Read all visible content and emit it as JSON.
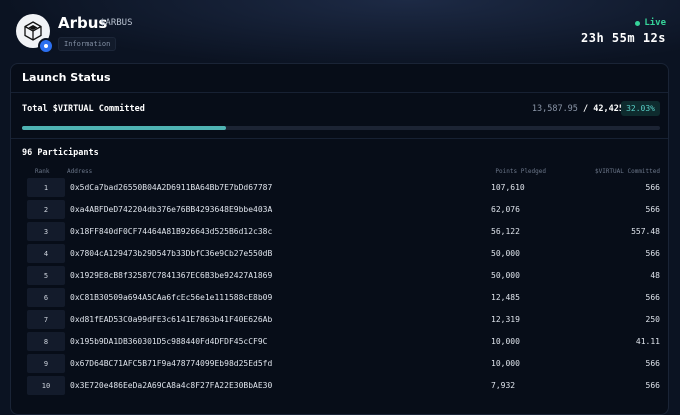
{
  "header": {
    "name": "Arbus",
    "ticker": "$ARBUS",
    "info_badge": "Information",
    "live_label": "Live",
    "countdown": "23h 55m 12s",
    "logo_icon": "cube-logo-icon",
    "verified_icon": "verified-badge-icon"
  },
  "launch": {
    "title": "Launch Status",
    "committed_label": "Total $VIRTUAL Committed",
    "committed_value": "13,587.95",
    "committed_sep": " / ",
    "committed_target": "42,425",
    "committed_pct": "32.03%",
    "progress_fraction": 0.3203,
    "accent_color": "#4fb3b3"
  },
  "participants": {
    "title": "96 Participants",
    "columns": [
      "Rank",
      "Address",
      "Points Pledged",
      "$VIRTUAL Committed"
    ],
    "rows": [
      {
        "rank": "1",
        "address": "0x5dCa7bad26550B04A2D6911BA64Bb7E7bDd67787",
        "points": "107,610",
        "virtual": "566"
      },
      {
        "rank": "2",
        "address": "0xa4ABFDeD742204db376e76BB4293648E9bbe403A",
        "points": "62,076",
        "virtual": "566"
      },
      {
        "rank": "3",
        "address": "0x18FF840dF0CF74464A81B926643d525B6d12c38c",
        "points": "56,122",
        "virtual": "557.48"
      },
      {
        "rank": "4",
        "address": "0x7804cA129473b29D547b33DbfC36e9Cb27e550dB",
        "points": "50,000",
        "virtual": "566"
      },
      {
        "rank": "5",
        "address": "0x1929E8cB8f32587C7841367EC6B3be92427A1869",
        "points": "50,000",
        "virtual": "48"
      },
      {
        "rank": "6",
        "address": "0xC81B30509a694A5CAa6fcEc56e1e111588cE8b09",
        "points": "12,485",
        "virtual": "566"
      },
      {
        "rank": "7",
        "address": "0xd81fEAD53C0a99dFE3c6141E7863b41F40E626Ab",
        "points": "12,319",
        "virtual": "250"
      },
      {
        "rank": "8",
        "address": "0x195b9DA1DB360301D5c988440Fd4DFDF45cCF9C",
        "points": "10,000",
        "virtual": "41.11"
      },
      {
        "rank": "9",
        "address": "0x67D64BC71AFC5B71F9a478774099Eb98d25Ed5fd",
        "points": "10,000",
        "virtual": "566"
      },
      {
        "rank": "10",
        "address": "0x3E720e486EeDa2A69CA8a4c8F27FA22E30BbAE30",
        "points": "7,932",
        "virtual": "566"
      }
    ]
  }
}
